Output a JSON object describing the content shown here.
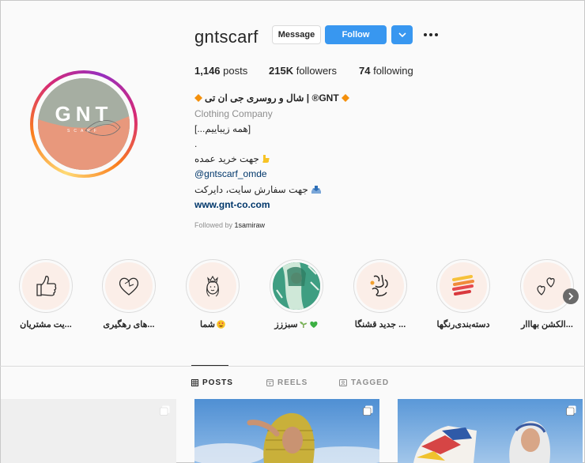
{
  "profile": {
    "username": "gntscarf",
    "message_label": "Message",
    "follow_label": "Follow",
    "stats": {
      "posts_count": "1,146",
      "posts_label": "posts",
      "followers_count": "215K",
      "followers_label": "followers",
      "following_count": "74",
      "following_label": "following"
    },
    "bio": {
      "name": "GNT® | شال و روسری جی ان تی",
      "category": "Clothing Company",
      "line1": "[...همه زیباییم]",
      "line2": ".",
      "line3": "جهت خرید عمده",
      "line4": "@gntscarf_omde",
      "line5": "جهت سفارش سایت، دایرکت",
      "website": "www.gnt-co.com",
      "followed_by_prefix": "Followed by",
      "followed_by_user": "1samiraw"
    },
    "avatar_logo": {
      "text": "GNT",
      "subtext": "SCARF"
    }
  },
  "highlights": [
    {
      "label": "...یت مشتریان",
      "icon": "thumbs-up-icon"
    },
    {
      "label": "...های رهگیری",
      "icon": "heart-icon"
    },
    {
      "label": "شما",
      "icon": "person-icon"
    },
    {
      "label": "سبززز",
      "icon": "scarf-photo"
    },
    {
      "label": "... جدید قشنگا",
      "icon": "calligraphy-icon"
    },
    {
      "label": "دسته‌بندی‌رنگها",
      "icon": "color-swatch-icon"
    },
    {
      "label": "...الکشن بهااار",
      "icon": "hearts-icon"
    }
  ],
  "tabs": [
    {
      "label": "POSTS",
      "icon": "grid-icon",
      "active": true
    },
    {
      "label": "REELS",
      "icon": "reels-icon",
      "active": false
    },
    {
      "label": "TAGGED",
      "icon": "tag-icon",
      "active": false
    }
  ],
  "colors": {
    "follow_blue": "#3897f0",
    "link_blue": "#00376b",
    "muted_gray": "#8e8e8e",
    "highlight_bg": "#fbeee8",
    "avatar_green": "#a6aea2",
    "avatar_salmon": "#e8987c"
  }
}
